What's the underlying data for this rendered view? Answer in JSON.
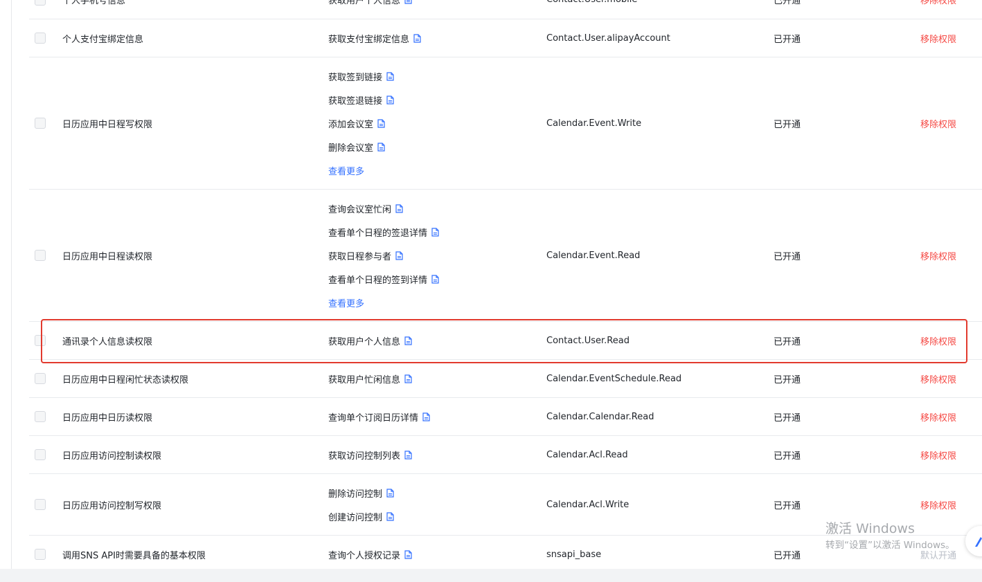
{
  "rows": [
    {
      "name": "个人手机号信息",
      "apis": [
        "获取用户个人信息"
      ],
      "more": "",
      "scope": "Contact.User.mobile",
      "status": "已开通",
      "action": "移除权限"
    },
    {
      "name": "个人支付宝绑定信息",
      "apis": [
        "获取支付宝绑定信息"
      ],
      "more": "",
      "scope": "Contact.User.alipayAccount",
      "status": "已开通",
      "action": "移除权限"
    },
    {
      "name": "日历应用中日程写权限",
      "apis": [
        "获取签到链接",
        "获取签退链接",
        "添加会议室",
        "删除会议室"
      ],
      "more": "查看更多",
      "scope": "Calendar.Event.Write",
      "status": "已开通",
      "action": "移除权限"
    },
    {
      "name": "日历应用中日程读权限",
      "apis": [
        "查询会议室忙闲",
        "查看单个日程的签退详情",
        "获取日程参与者",
        "查看单个日程的签到详情"
      ],
      "more": "查看更多",
      "scope": "Calendar.Event.Read",
      "status": "已开通",
      "action": "移除权限"
    },
    {
      "name": "通讯录个人信息读权限",
      "apis": [
        "获取用户个人信息"
      ],
      "more": "",
      "scope": "Contact.User.Read",
      "status": "已开通",
      "action": "移除权限"
    },
    {
      "name": "日历应用中日程闲忙状态读权限",
      "apis": [
        "获取用户忙闲信息"
      ],
      "more": "",
      "scope": "Calendar.EventSchedule.Read",
      "status": "已开通",
      "action": "移除权限"
    },
    {
      "name": "日历应用中日历读权限",
      "apis": [
        "查询单个订阅日历详情"
      ],
      "more": "",
      "scope": "Calendar.Calendar.Read",
      "status": "已开通",
      "action": "移除权限"
    },
    {
      "name": "日历应用访问控制读权限",
      "apis": [
        "获取访问控制列表"
      ],
      "more": "",
      "scope": "Calendar.Acl.Read",
      "status": "已开通",
      "action": "移除权限"
    },
    {
      "name": "日历应用访问控制写权限",
      "apis": [
        "删除访问控制",
        "创建访问控制"
      ],
      "more": "",
      "scope": "Calendar.Acl.Write",
      "status": "已开通",
      "action": "移除权限"
    },
    {
      "name": "调用SNS API时需要具备的基本权限",
      "apis": [
        "查询个人授权记录"
      ],
      "more": "",
      "scope": "snsapi_base",
      "status": "已开通",
      "action": "默认开通"
    }
  ],
  "watermark": {
    "line1": "激活 Windows",
    "line2": "转到“设置”以激活 Windows。"
  },
  "colors": {
    "remove": "#f54a45",
    "link": "#3370ff",
    "highlight": "#e23a2e"
  }
}
